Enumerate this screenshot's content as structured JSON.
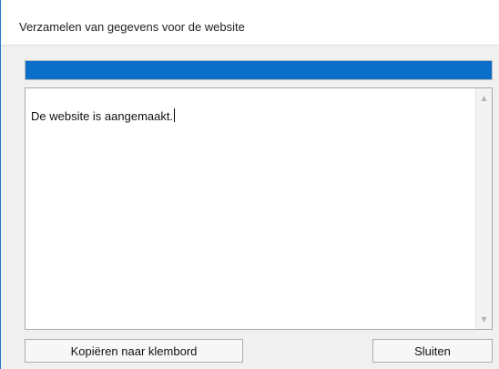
{
  "dialog": {
    "title": "Verzamelen van gegevens voor de website"
  },
  "progress": {
    "percent": 100,
    "color": "#0b6fc9"
  },
  "log": {
    "text": "De website is aangemaakt."
  },
  "scrollbar": {
    "up_icon": "▲",
    "down_icon": "▼"
  },
  "buttons": {
    "copy_label": "Kopiëren naar klembord",
    "close_label": "Sluiten"
  }
}
